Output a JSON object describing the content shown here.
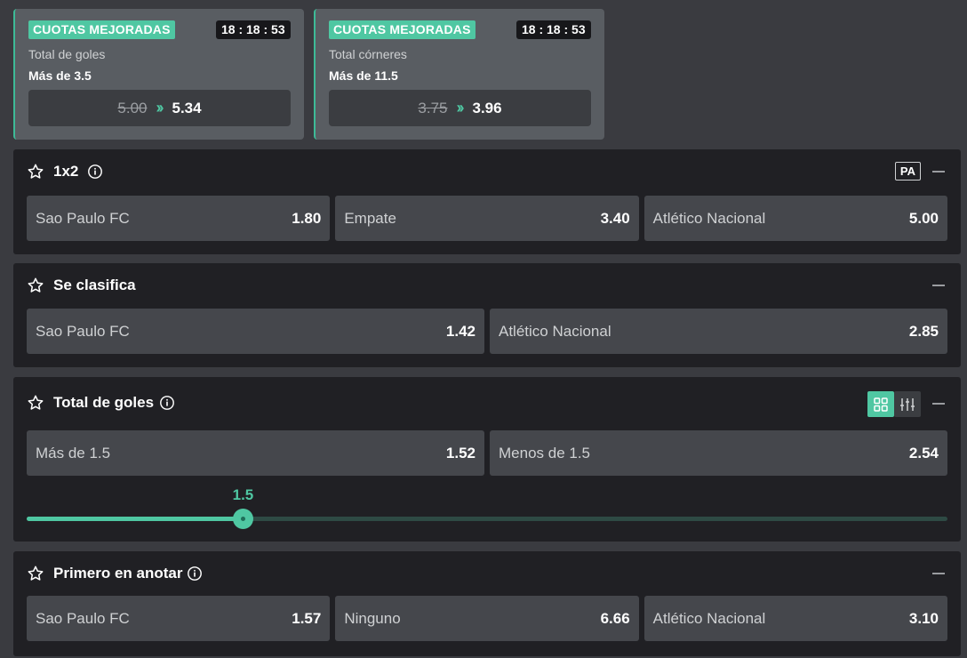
{
  "boosts": [
    {
      "badge": "CUOTAS MEJORADAS",
      "timer": "18 : 18 : 53",
      "market": "Total de goles",
      "selection": "Más de 3.5",
      "old_odd": "5.00",
      "new_odd": "5.34"
    },
    {
      "badge": "CUOTAS MEJORADAS",
      "timer": "18 : 18 : 53",
      "market": "Total córneres",
      "selection": "Más de 11.5",
      "old_odd": "3.75",
      "new_odd": "3.96"
    }
  ],
  "markets": {
    "m1x2": {
      "title": "1x2",
      "pa": "PA",
      "selections": [
        {
          "name": "Sao Paulo FC",
          "odd": "1.80"
        },
        {
          "name": "Empate",
          "odd": "3.40"
        },
        {
          "name": "Atlético Nacional",
          "odd": "5.00"
        }
      ]
    },
    "clasifica": {
      "title": "Se clasifica",
      "selections": [
        {
          "name": "Sao Paulo FC",
          "odd": "1.42"
        },
        {
          "name": "Atlético Nacional",
          "odd": "2.85"
        }
      ]
    },
    "goles": {
      "title": "Total de goles",
      "selections": [
        {
          "name": "Más de 1.5",
          "odd": "1.52"
        },
        {
          "name": "Menos de 1.5",
          "odd": "2.54"
        }
      ],
      "slider": {
        "value": "1.5",
        "fraction": 0.235
      }
    },
    "primero": {
      "title": "Primero en anotar",
      "selections": [
        {
          "name": "Sao Paulo FC",
          "odd": "1.57"
        },
        {
          "name": "Ninguno",
          "odd": "6.66"
        },
        {
          "name": "Atlético Nacional",
          "odd": "3.10"
        }
      ]
    }
  },
  "colors": {
    "accent": "#4fc7a2",
    "panel": "#202024",
    "button": "#45474c"
  }
}
